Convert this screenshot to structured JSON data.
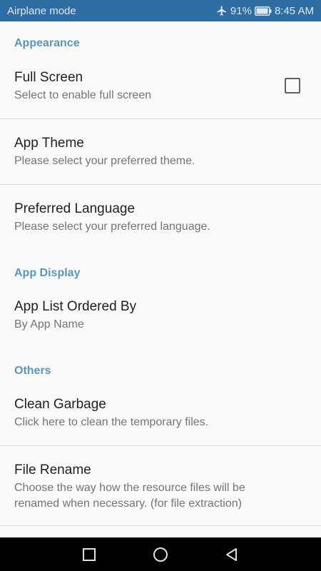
{
  "status_bar": {
    "mode_text": "Airplane mode",
    "battery_text": "91%",
    "time": "8:45 AM",
    "icons": [
      "airplane-icon",
      "battery-icon"
    ]
  },
  "sections": {
    "appearance": {
      "header": "Appearance",
      "full_screen": {
        "title": "Full Screen",
        "summary": "Select to enable full screen",
        "checked": false
      },
      "app_theme": {
        "title": "App Theme",
        "summary": "Please select your preferred theme."
      },
      "preferred_language": {
        "title": "Preferred Language",
        "summary": "Please select your preferred language."
      }
    },
    "app_display": {
      "header": "App Display",
      "app_list_ordered_by": {
        "title": "App List Ordered By",
        "summary": "By App Name"
      }
    },
    "others": {
      "header": "Others",
      "clean_garbage": {
        "title": "Clean Garbage",
        "summary": "Click here to clean the temporary files."
      },
      "file_rename": {
        "title": "File Rename",
        "summary": "Choose the way how the resource files will be renamed when necessary. (for file extraction)"
      }
    }
  },
  "nav_bar": {
    "buttons": [
      "recents-icon",
      "home-icon",
      "back-icon"
    ]
  },
  "colors": {
    "status_bar": "#2e6da4",
    "section_header": "#5b97b5",
    "background": "#fafafa",
    "title_text": "#212121",
    "summary_text": "#757575"
  }
}
